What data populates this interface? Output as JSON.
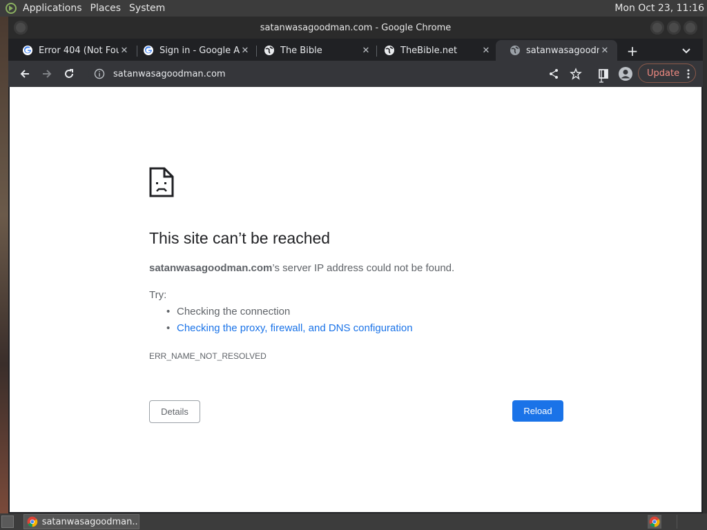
{
  "panel": {
    "menus": [
      "Applications",
      "Places",
      "System"
    ],
    "clock": "Mon Oct 23, 11:16"
  },
  "window": {
    "title": "satanwasagoodman.com - Google Chrome"
  },
  "tabs": [
    {
      "title": "Error 404 (Not Fou",
      "favicon": "google-icon",
      "active": false
    },
    {
      "title": "Sign in - Google Ac",
      "favicon": "google-icon",
      "active": false
    },
    {
      "title": "The Bible",
      "favicon": "globe-icon",
      "active": false
    },
    {
      "title": "TheBible.net",
      "favicon": "globe-icon",
      "active": false
    },
    {
      "title": "satanwasagoodma",
      "favicon": "globe-icon",
      "active": true
    }
  ],
  "toolbar": {
    "url": "satanwasagoodman.com",
    "update_label": "Update"
  },
  "error_page": {
    "title": "This site can’t be reached",
    "host": "satanwasagoodman.com",
    "desc_suffix": "’s server IP address could not be found.",
    "try_label": "Try:",
    "suggestions": [
      "Checking the connection",
      "Checking the proxy, firewall, and DNS configuration"
    ],
    "error_code": "ERR_NAME_NOT_RESOLVED",
    "details_label": "Details",
    "reload_label": "Reload"
  },
  "taskbar": {
    "item_label": "satanwasagoodman..."
  },
  "colors": {
    "accent": "#1a73e8",
    "update": "#f28b82"
  }
}
